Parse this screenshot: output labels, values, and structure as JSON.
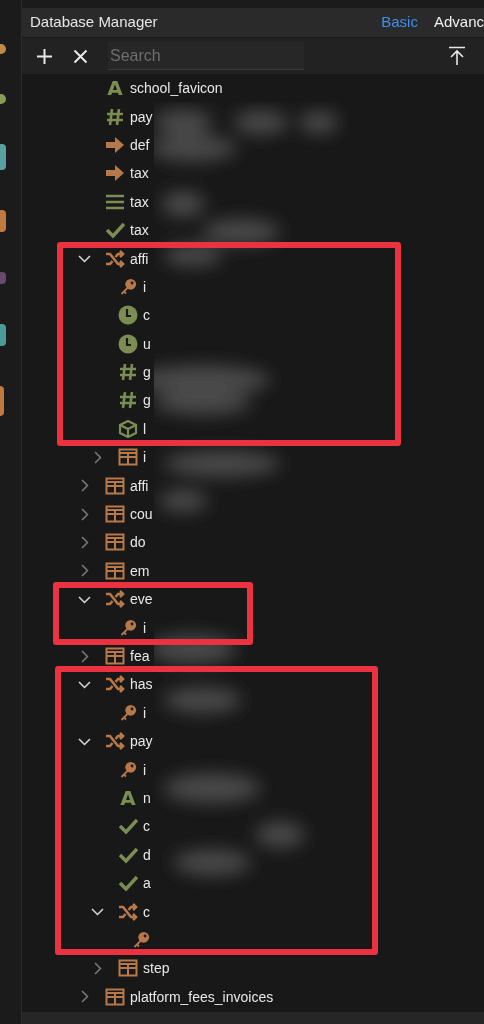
{
  "window": {
    "title": "Database Manager"
  },
  "tabs": [
    {
      "label": "Basic",
      "selected": true
    },
    {
      "label": "Advanc",
      "selected": false
    }
  ],
  "toolbar": {
    "search": {
      "placeholder": "Search"
    }
  },
  "tree": [
    {
      "label": "school_favicon",
      "kind": "text",
      "glyph": "A"
    },
    {
      "label": "pay",
      "kind": "number"
    },
    {
      "label": "def",
      "kind": "link"
    },
    {
      "label": "tax",
      "kind": "link"
    },
    {
      "label": "tax",
      "kind": "list"
    },
    {
      "label": "tax",
      "kind": "boolean"
    },
    {
      "label": "affi",
      "kind": "relation",
      "expanded": true,
      "children": [
        {
          "label": "i",
          "kind": "key"
        },
        {
          "label": "c",
          "kind": "datetime"
        },
        {
          "label": "u",
          "kind": "datetime"
        },
        {
          "label": "g",
          "kind": "number"
        },
        {
          "label": "g",
          "kind": "number"
        },
        {
          "label": "l",
          "kind": "object"
        },
        {
          "label": "i",
          "kind": "table",
          "expanded": false
        }
      ]
    },
    {
      "label": "affi",
      "kind": "table",
      "expanded": false
    },
    {
      "label": "cou",
      "kind": "table",
      "expanded": false
    },
    {
      "label": "do",
      "kind": "table",
      "expanded": false
    },
    {
      "label": "em",
      "kind": "table",
      "expanded": false
    },
    {
      "label": "eve",
      "kind": "relation",
      "expanded": true,
      "children": [
        {
          "label": "i",
          "kind": "key"
        }
      ]
    },
    {
      "label": "fea",
      "kind": "table",
      "expanded": false
    },
    {
      "label": "has",
      "kind": "relation",
      "expanded": true,
      "children": [
        {
          "label": "i",
          "kind": "key"
        }
      ]
    },
    {
      "label": "pay",
      "kind": "relation",
      "expanded": true,
      "children": [
        {
          "label": "i",
          "kind": "key"
        },
        {
          "label": "n",
          "kind": "text",
          "glyph": "A"
        },
        {
          "label": "c",
          "kind": "boolean"
        },
        {
          "label": "d",
          "kind": "boolean"
        },
        {
          "label": "a",
          "kind": "boolean"
        },
        {
          "label": "c",
          "kind": "relation",
          "expanded": true,
          "children": [
            {
              "kind": "key"
            }
          ]
        },
        {
          "label": "step",
          "kind": "table",
          "expanded": false
        }
      ]
    },
    {
      "label": "platform_fees_invoices",
      "kind": "table",
      "expanded": false
    }
  ]
}
